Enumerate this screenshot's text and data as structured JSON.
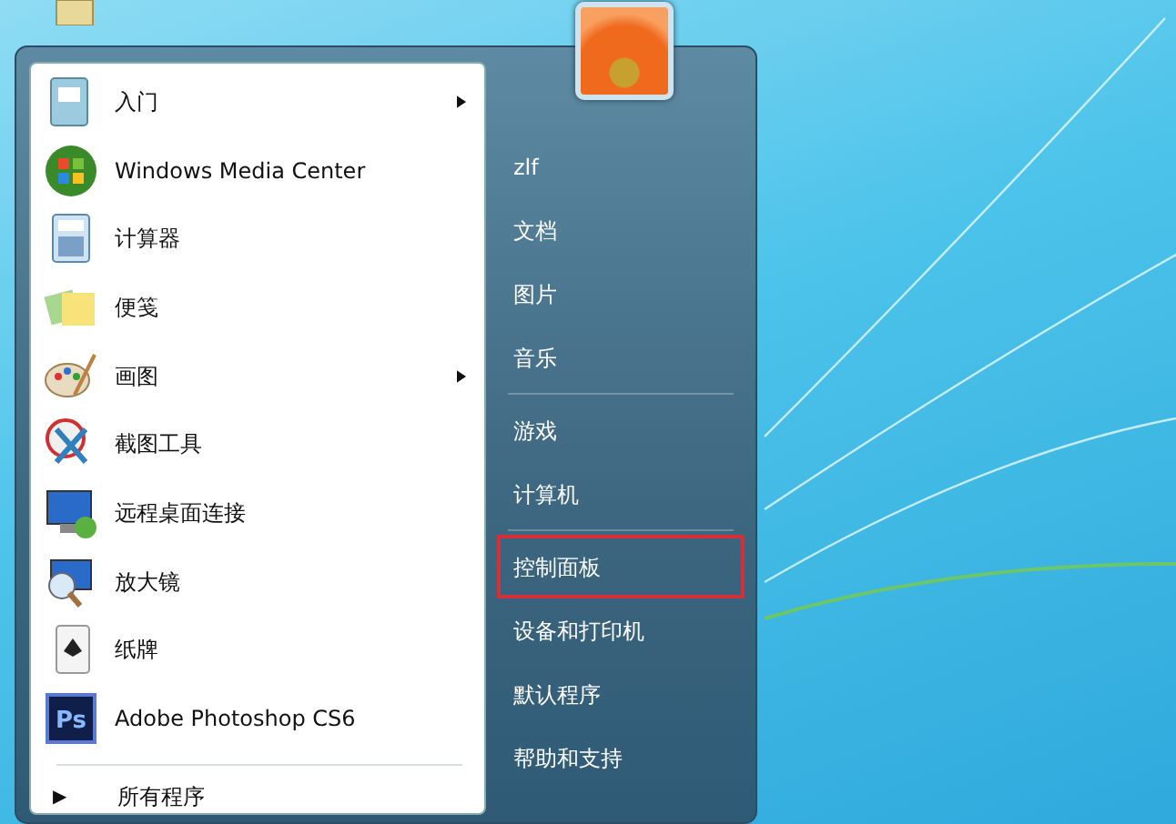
{
  "start_menu": {
    "programs": [
      {
        "label": "入门",
        "has_submenu": true
      },
      {
        "label": "Windows Media Center",
        "has_submenu": false
      },
      {
        "label": "计算器",
        "has_submenu": false
      },
      {
        "label": "便笺",
        "has_submenu": false
      },
      {
        "label": "画图",
        "has_submenu": true
      },
      {
        "label": "截图工具",
        "has_submenu": false
      },
      {
        "label": "远程桌面连接",
        "has_submenu": false
      },
      {
        "label": "放大镜",
        "has_submenu": false
      },
      {
        "label": "纸牌",
        "has_submenu": false
      },
      {
        "label": "Adobe Photoshop CS6",
        "has_submenu": false,
        "icon_text": "Ps"
      }
    ],
    "all_programs": {
      "arrow": "▶",
      "label": "所有程序"
    },
    "places": [
      [
        {
          "label": "zlf",
          "highlighted": false
        },
        {
          "label": "文档",
          "highlighted": false
        },
        {
          "label": "图片",
          "highlighted": false
        },
        {
          "label": "音乐",
          "highlighted": false
        }
      ],
      [
        {
          "label": "游戏",
          "highlighted": false
        },
        {
          "label": "计算机",
          "highlighted": false
        }
      ],
      [
        {
          "label": "控制面板",
          "highlighted": true
        },
        {
          "label": "设备和打印机",
          "highlighted": false
        },
        {
          "label": "默认程序",
          "highlighted": false
        },
        {
          "label": "帮助和支持",
          "highlighted": false
        }
      ]
    ]
  }
}
